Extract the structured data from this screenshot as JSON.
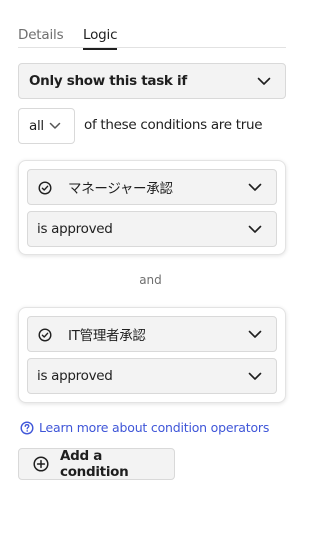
{
  "tabs": {
    "details": "Details",
    "logic": "Logic",
    "active": "Logic"
  },
  "visibility": {
    "label": "Only show this task if"
  },
  "match": {
    "value": "all",
    "suffix": "of these conditions are true"
  },
  "conditions": [
    {
      "field": "マネージャー承認",
      "operator": "is approved"
    },
    {
      "field": "IT管理者承認",
      "operator": "is approved"
    }
  ],
  "joiner": "and",
  "help_link": "Learn more about condition operators",
  "add_button": "Add a condition",
  "colors": {
    "link": "#3f56d8",
    "field_bg": "#f3f3f3",
    "text": "#1f1f1f",
    "muted": "#6f6f6f"
  },
  "icons": {
    "chevron": "chevron-down-icon",
    "check": "check-circle-icon",
    "help": "help-circle-icon",
    "add": "plus-circle-icon"
  }
}
